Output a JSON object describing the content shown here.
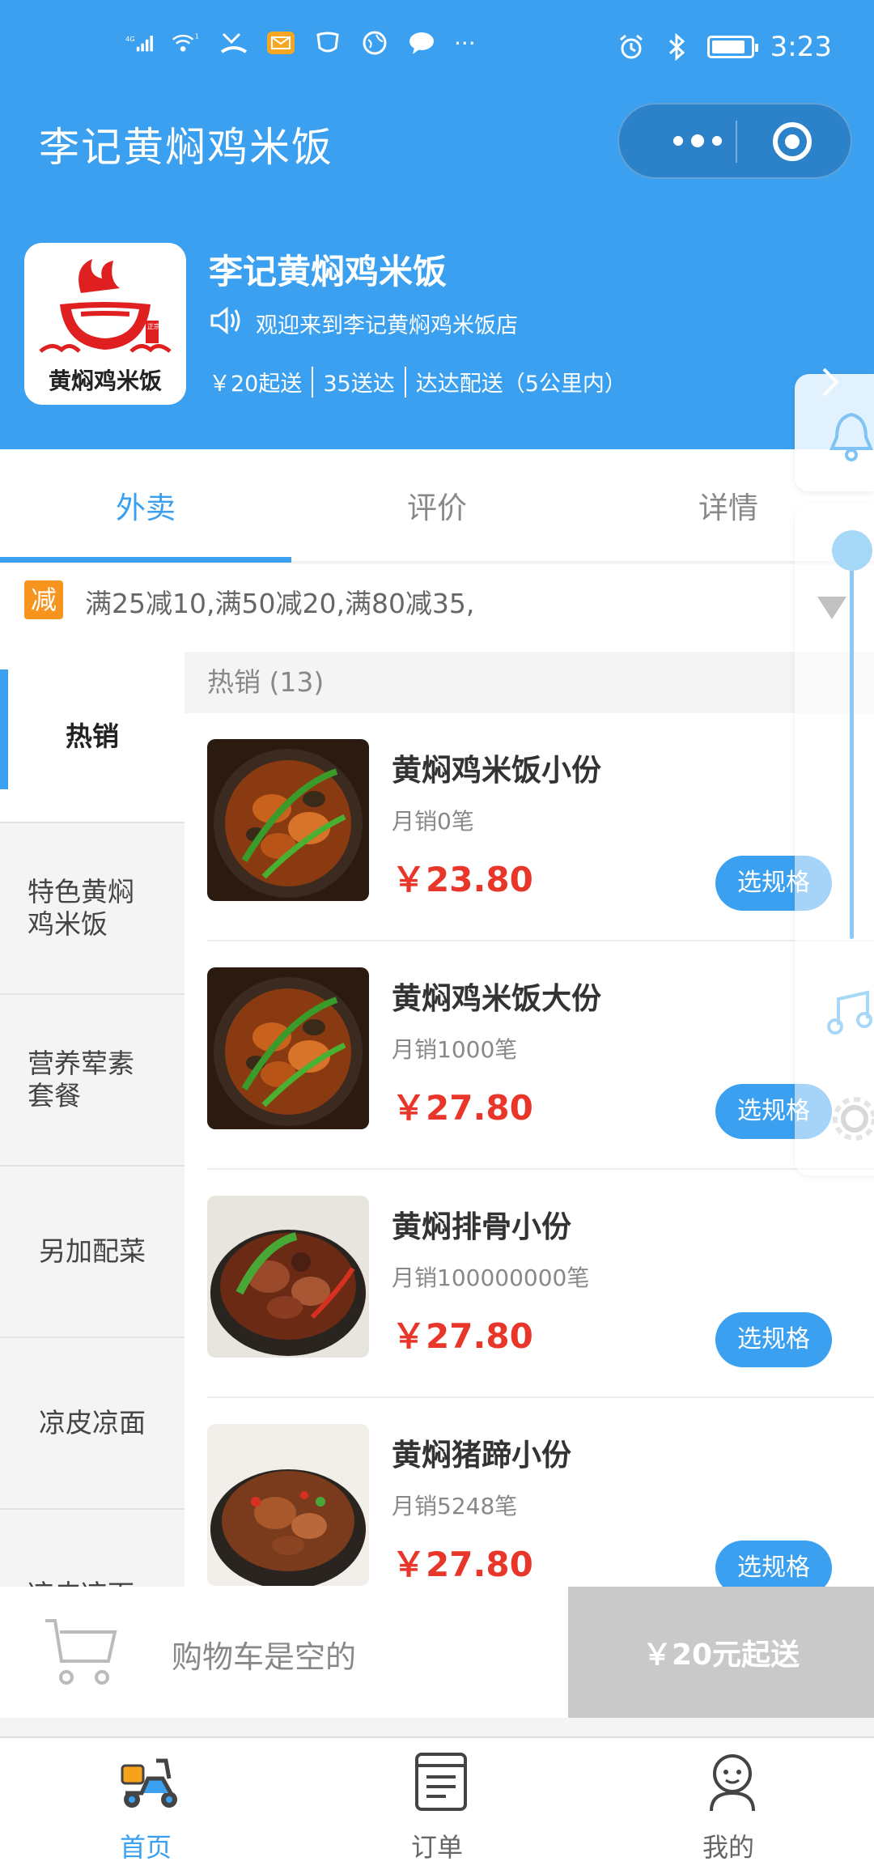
{
  "status_bar": {
    "network": "4G",
    "signal_badge": "1",
    "time": "3:23",
    "more": "···"
  },
  "header": {
    "title": "李记黄焖鸡米饭"
  },
  "shop": {
    "name": "李记黄焖鸡米饭",
    "notice": "观迎来到李记黄焖鸡米饭店",
    "min_order": "￥20起送",
    "delivery_fee": "35送达",
    "delivery_info": "达达配送（5公里内）",
    "logo_brand_text": "黄焖鸡米饭",
    "logo_seal": "正宗"
  },
  "tabs": [
    {
      "label": "外卖",
      "active": true
    },
    {
      "label": "评价",
      "active": false
    },
    {
      "label": "详情",
      "active": false
    }
  ],
  "promo": {
    "tag": "减",
    "text": "满25减10,满50减20,满80减35,"
  },
  "categories": [
    {
      "label": "热销",
      "active": true
    },
    {
      "label": "特色黄焖\n鸡米饭",
      "active": false
    },
    {
      "label": "营养荤素\n套餐",
      "active": false
    },
    {
      "label": "另加配菜",
      "active": false
    },
    {
      "label": "凉皮凉面",
      "active": false
    },
    {
      "label": "凉皮凉面",
      "active": false
    }
  ],
  "list": {
    "section_title": "热销 (13)",
    "items": [
      {
        "name": "黄焖鸡米饭小份",
        "sales": "月销0笔",
        "price": "￥23.80",
        "button": "选规格"
      },
      {
        "name": "黄焖鸡米饭大份",
        "sales": "月销1000笔",
        "price": "￥27.80",
        "button": "选规格"
      },
      {
        "name": "黄焖排骨小份",
        "sales": "月销100000000笔",
        "price": "￥27.80",
        "button": "选规格"
      },
      {
        "name": "黄焖猪蹄小份",
        "sales": "月销5248笔",
        "price": "￥27.80",
        "button": "选规格"
      }
    ]
  },
  "cart": {
    "empty_text": "购物车是空的",
    "checkout_label": "￥20元起送"
  },
  "bottom_nav": [
    {
      "label": "首页",
      "icon": "scooter-icon",
      "active": true
    },
    {
      "label": "订单",
      "icon": "order-list-icon",
      "active": false
    },
    {
      "label": "我的",
      "icon": "user-icon",
      "active": false
    }
  ],
  "colors": {
    "primary": "#3aa0ef",
    "price": "#e8372a",
    "promo_tag": "#f7941d",
    "checkout_disabled": "#c9c9c9"
  }
}
